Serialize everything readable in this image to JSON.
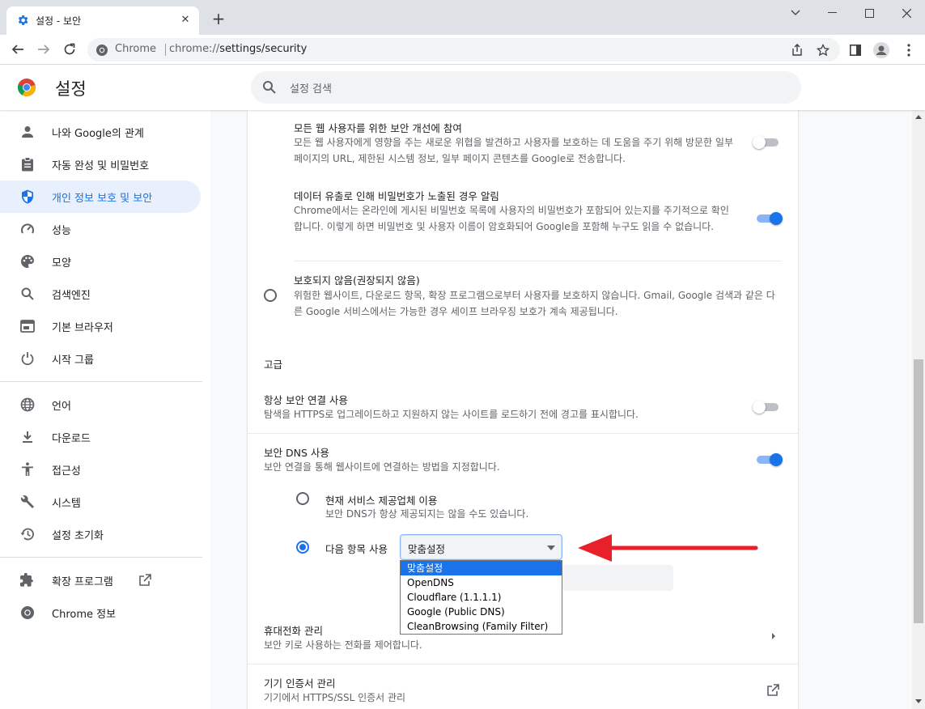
{
  "window": {
    "tab_title": "설정 - 보안",
    "tab_close": "✕",
    "new_tab": "+",
    "minimize": "minimize-icon",
    "maximize": "maximize-icon",
    "close": "close-icon",
    "chevron": "chevron-down-icon"
  },
  "toolbar": {
    "chip_label": "Chrome",
    "url_prefix": "chrome://",
    "url_path": "settings/security"
  },
  "header": {
    "title": "설정",
    "search_placeholder": "설정 검색"
  },
  "sidebar": {
    "items": [
      {
        "label": "나와 Google의 관계",
        "icon": "person-icon"
      },
      {
        "label": "자동 완성 및 비밀번호",
        "icon": "clipboard-icon"
      },
      {
        "label": "개인 정보 보호 및 보안",
        "icon": "shield-icon",
        "active": true
      },
      {
        "label": "성능",
        "icon": "speedometer-icon"
      },
      {
        "label": "모양",
        "icon": "palette-icon"
      },
      {
        "label": "검색엔진",
        "icon": "search-icon"
      },
      {
        "label": "기본 브라우저",
        "icon": "browser-icon"
      },
      {
        "label": "시작 그룹",
        "icon": "power-icon"
      },
      {
        "label": "언어",
        "icon": "globe-icon"
      },
      {
        "label": "다운로드",
        "icon": "download-icon"
      },
      {
        "label": "접근성",
        "icon": "accessibility-icon"
      },
      {
        "label": "시스템",
        "icon": "wrench-icon"
      },
      {
        "label": "설정 초기화",
        "icon": "history-icon"
      },
      {
        "label": "확장 프로그램",
        "icon": "puzzle-icon"
      },
      {
        "label": "Chrome 정보",
        "icon": "chrome-icon"
      }
    ]
  },
  "main": {
    "improve": {
      "title": "모든 웹 사용자를 위한 보안 개선에 참여",
      "desc": "모든 웹 사용자에게 영향을 주는 새로운 위협을 발견하고 사용자를 보호하는 데 도움을 주기 위해 방문한 일부 페이지의 URL, 제한된 시스템 정보, 일부 페이지 콘텐츠를 Google로 전송합니다.",
      "enabled": false
    },
    "leak_alert": {
      "title": "데이터 유출로 인해 비밀번호가 노출된 경우 알림",
      "desc": "Chrome에서는 온라인에 게시된 비밀번호 목록에 사용자의 비밀번호가 포함되어 있는지를 주기적으로 확인합니다. 이렇게 하면 비밀번호 및 사용자 이름이 암호화되어 Google을 포함해 누구도 읽을 수 없습니다.",
      "enabled": true
    },
    "no_protection": {
      "title": "보호되지 않음(권장되지 않음)",
      "desc": "위험한 웹사이트, 다운로드 항목, 확장 프로그램으로부터 사용자를 보호하지 않습니다. Gmail, Google 검색과 같은 다른 Google 서비스에서는 가능한 경우 세이프 브라우징 보호가 계속 제공됩니다.",
      "selected": false
    },
    "advanced_label": "고급",
    "https": {
      "title": "항상 보안 연결 사용",
      "desc": "탐색을 HTTPS로 업그레이드하고 지원하지 않는 사이트를 로드하기 전에 경고를 표시합니다.",
      "enabled": false
    },
    "secure_dns": {
      "title": "보안 DNS 사용",
      "desc": "보안 연결을 통해 웹사이트에 연결하는 방법을 지정합니다.",
      "enabled": true,
      "current_provider_title": "현재 서비스 제공업체 이용",
      "current_provider_desc": "보안 DNS가 항상 제공되지는 않을 수도 있습니다.",
      "custom_label": "다음 항목 사용",
      "selected_value": "맞춤설정",
      "options": [
        "맞춤설정",
        "OpenDNS",
        "Cloudflare (1.1.1.1)",
        "Google (Public DNS)",
        "CleanBrowsing (Family Filter)"
      ]
    },
    "phones": {
      "title": "휴대전화 관리",
      "desc": "보안 키로 사용하는 전화를 제어합니다."
    },
    "certs": {
      "title": "기기 인증서 관리",
      "desc": "기기에서 HTTPS/SSL 인증서 관리"
    }
  },
  "colors": {
    "accent": "#1a73e8",
    "annotation_arrow": "#e8202a"
  }
}
